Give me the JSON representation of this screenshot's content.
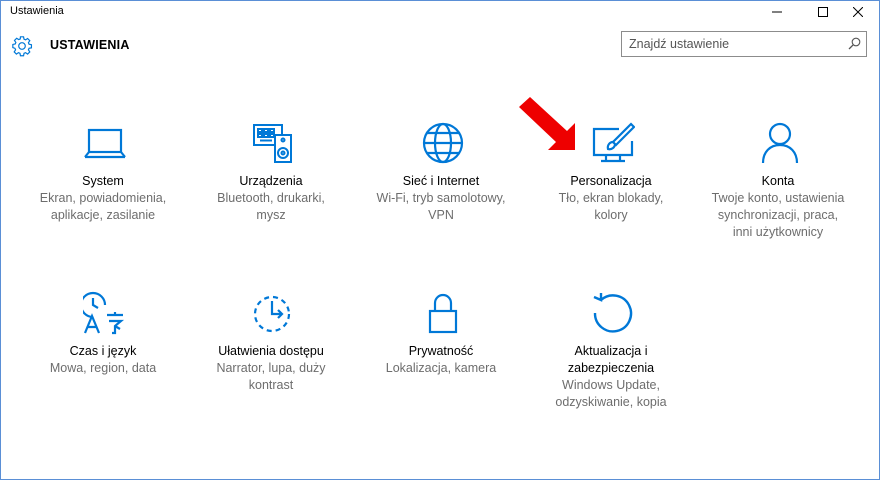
{
  "window": {
    "title": "Ustawienia",
    "minimize_icon": "minimize-icon",
    "maximize_icon": "maximize-icon",
    "close_icon": "close-icon"
  },
  "header": {
    "icon": "gear-icon",
    "title": "USTAWIENIA",
    "search": {
      "placeholder": "Znajdź ustawienie",
      "value": "",
      "icon": "search-icon"
    }
  },
  "accent_color": "#0078d7",
  "annotation": {
    "icon": "red-arrow",
    "color": "#ee0000"
  },
  "tiles": [
    {
      "icon": "laptop-icon",
      "name": "System",
      "desc": [
        "Ekran, powiadomienia,",
        "aplikacje, zasilanie"
      ]
    },
    {
      "icon": "devices-icon",
      "name": "Urządzenia",
      "desc": [
        "Bluetooth, drukarki,",
        "mysz"
      ]
    },
    {
      "icon": "globe-icon",
      "name": "Sieć i Internet",
      "desc": [
        "Wi-Fi, tryb samolotowy,",
        "VPN"
      ]
    },
    {
      "icon": "personalization-icon",
      "name": "Personalizacja",
      "desc": [
        "Tło, ekran blokady,",
        "kolory"
      ]
    },
    {
      "icon": "person-icon",
      "name": "Konta",
      "desc": [
        "Twoje konto, ustawienia",
        "synchronizacji, praca,",
        "inni użytkownicy"
      ]
    },
    {
      "icon": "time-language-icon",
      "name": "Czas i język",
      "desc": [
        "Mowa, region, data"
      ]
    },
    {
      "icon": "ease-of-access-icon",
      "name": "Ułatwienia dostępu",
      "desc": [
        "Narrator, lupa, duży",
        "kontrast"
      ]
    },
    {
      "icon": "lock-icon",
      "name": "Prywatność",
      "desc": [
        "Lokalizacja, kamera"
      ]
    },
    {
      "icon": "update-icon",
      "name": "Aktualizacja i",
      "name2": "zabezpieczenia",
      "desc": [
        "Windows Update,",
        "odzyskiwanie, kopia"
      ]
    }
  ]
}
